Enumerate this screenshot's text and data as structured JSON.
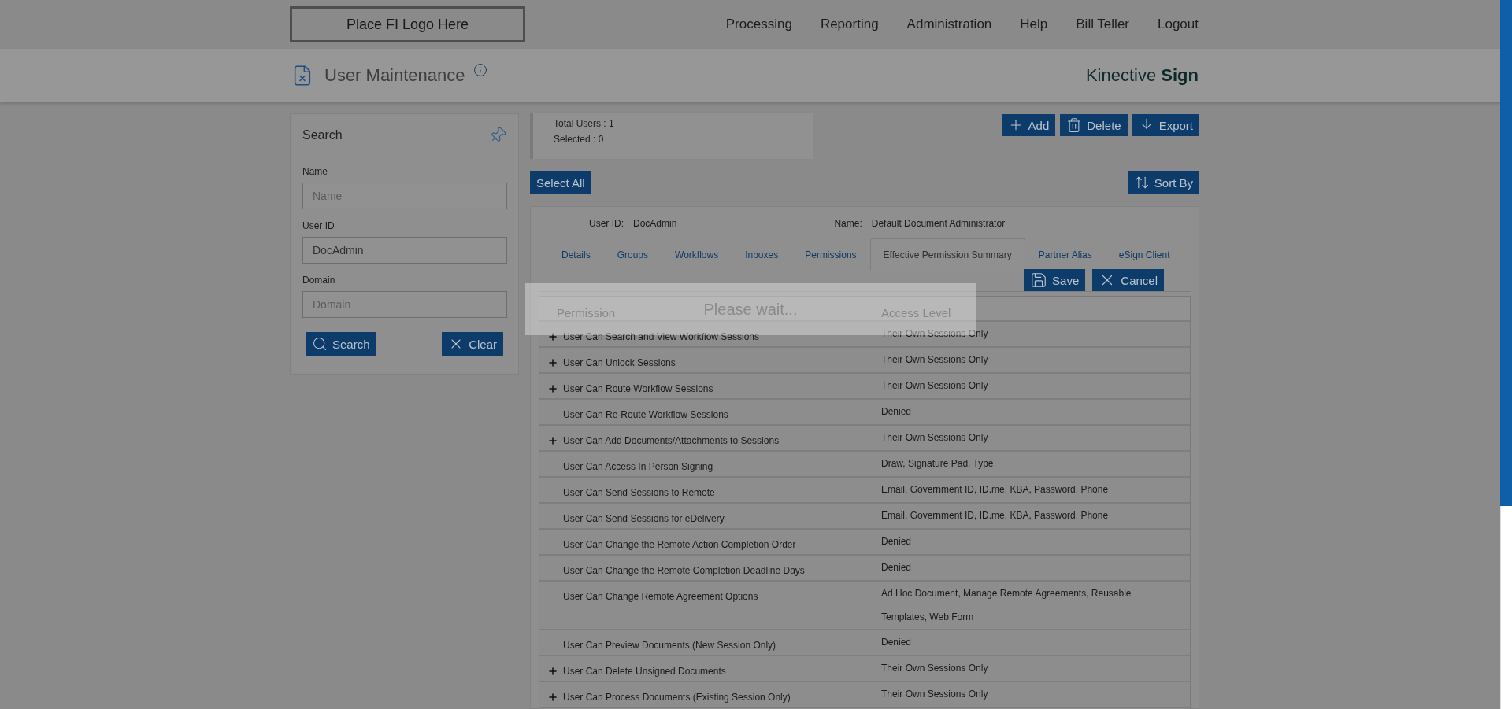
{
  "header": {
    "logo_placeholder": "Place FI Logo Here",
    "nav": [
      "Processing",
      "Reporting",
      "Administration",
      "Help",
      "Bill Teller",
      "Logout"
    ]
  },
  "page": {
    "title": "User Maintenance",
    "brand": "Kinective **Sign**"
  },
  "search_panel": {
    "title": "Search",
    "fields": [
      {
        "label": "Name",
        "placeholder": "Name"
      },
      {
        "label": "User ID",
        "value": "DocAdmin"
      },
      {
        "label": "Domain",
        "placeholder": "Domain"
      }
    ],
    "buttons": [
      "Search",
      "Clear"
    ]
  },
  "stats": [
    "Total Users : 1",
    "Selected : 0"
  ],
  "toolbar": [
    "Add",
    "Delete",
    "Export"
  ],
  "select_all": "Select All",
  "sort_by": "Sort By",
  "user": {
    "id_label": "User ID:",
    "id": "DocAdmin",
    "name_label": "Name:",
    "name": "Default Document Administrator"
  },
  "tabs": [
    {
      "label": "Details",
      "selected": false
    },
    {
      "label": "Groups",
      "selected": false
    },
    {
      "label": "Workflows",
      "selected": false
    },
    {
      "label": "Inboxes",
      "selected": false
    },
    {
      "label": "Permissions",
      "selected": false
    },
    {
      "label": "Effective Permission Summary",
      "selected": true
    },
    {
      "label": "Partner Alias",
      "selected": false
    },
    {
      "label": "eSign Client",
      "selected": false
    }
  ],
  "actions": [
    "Save",
    "Cancel"
  ],
  "table": {
    "columns": [
      "Permission",
      "Access Level"
    ],
    "rows": [
      {
        "permission": "User Can Search and View Workflow Sessions",
        "access": "Their Own Sessions Only",
        "expandable": true
      },
      {
        "permission": "User Can Unlock Sessions",
        "access": "Their Own Sessions Only",
        "expandable": true
      },
      {
        "permission": "User Can Route Workflow Sessions",
        "access": "Their Own Sessions Only",
        "expandable": true
      },
      {
        "permission": "User Can Re-Route Workflow Sessions",
        "access": "Denied",
        "expandable": false
      },
      {
        "permission": "User Can Add Documents/Attachments to Sessions",
        "access": "Their Own Sessions Only",
        "expandable": true
      },
      {
        "permission": "User Can Access In Person Signing",
        "access": "Draw, Signature Pad, Type",
        "expandable": false
      },
      {
        "permission": "User Can Send Sessions to Remote",
        "access": "Email, Government ID, ID.me, KBA, Password, Phone",
        "expandable": false
      },
      {
        "permission": "User Can Send Sessions for eDelivery",
        "access": "Email, Government ID, ID.me, KBA, Password, Phone",
        "expandable": false
      },
      {
        "permission": "User Can Change the Remote Action Completion Order",
        "access": "Denied",
        "expandable": false
      },
      {
        "permission": "User Can Change the Remote Completion Deadline Days",
        "access": "Denied",
        "expandable": false
      },
      {
        "permission": "User Can Change Remote Agreement Options",
        "access": "Ad Hoc Document, Manage Remote Agreements, Reusable Templates, Web Form",
        "expandable": false
      },
      {
        "permission": "User Can Preview Documents (New Session Only)",
        "access": "Denied",
        "expandable": false
      },
      {
        "permission": "User Can Delete Unsigned Documents",
        "access": "Their Own Sessions Only",
        "expandable": true
      },
      {
        "permission": "User Can Process Documents (Existing Session Only)",
        "access": "Their Own Sessions Only",
        "expandable": true
      }
    ]
  },
  "loading": {
    "message": "Please wait..."
  }
}
